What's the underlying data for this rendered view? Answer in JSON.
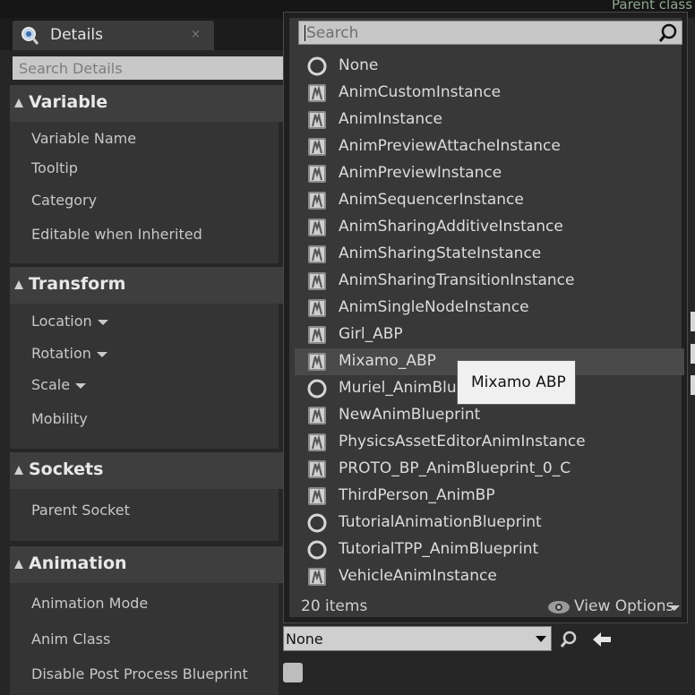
{
  "header": {
    "parent_class_label": "Parent class"
  },
  "details_tab": {
    "title": "Details",
    "close": "×"
  },
  "search_details": {
    "placeholder": "Search Details"
  },
  "categories": [
    {
      "name": "Variable",
      "props": [
        "Variable Name",
        "Tooltip",
        "Category",
        "Editable when Inherited"
      ]
    },
    {
      "name": "Transform",
      "props": [
        "Location",
        "Rotation",
        "Scale",
        "Mobility"
      ]
    },
    {
      "name": "Sockets",
      "props": [
        "Parent Socket"
      ]
    },
    {
      "name": "Animation",
      "props": [
        "Animation Mode",
        "Anim Class",
        "Disable Post Process Blueprint"
      ]
    }
  ],
  "class_picker": {
    "search_placeholder": "Search",
    "items": [
      {
        "label": "None",
        "icon": "circle-icon"
      },
      {
        "label": "AnimCustomInstance",
        "icon": "anim-blueprint-icon"
      },
      {
        "label": "AnimInstance",
        "icon": "anim-blueprint-icon"
      },
      {
        "label": "AnimPreviewAttacheInstance",
        "icon": "anim-blueprint-icon"
      },
      {
        "label": "AnimPreviewInstance",
        "icon": "anim-blueprint-icon"
      },
      {
        "label": "AnimSequencerInstance",
        "icon": "anim-blueprint-icon"
      },
      {
        "label": "AnimSharingAdditiveInstance",
        "icon": "anim-blueprint-icon"
      },
      {
        "label": "AnimSharingStateInstance",
        "icon": "anim-blueprint-icon"
      },
      {
        "label": "AnimSharingTransitionInstance",
        "icon": "anim-blueprint-icon"
      },
      {
        "label": "AnimSingleNodeInstance",
        "icon": "anim-blueprint-icon"
      },
      {
        "label": "Girl_ABP",
        "icon": "anim-blueprint-icon"
      },
      {
        "label": "Mixamo_ABP",
        "icon": "anim-blueprint-icon",
        "hovered": true
      },
      {
        "label": "Muriel_AnimBlueprint",
        "icon": "circle-icon"
      },
      {
        "label": "NewAnimBlueprint",
        "icon": "anim-blueprint-icon"
      },
      {
        "label": "PhysicsAssetEditorAnimInstance",
        "icon": "anim-blueprint-icon"
      },
      {
        "label": "PROTO_BP_AnimBlueprint_0_C",
        "icon": "anim-blueprint-icon"
      },
      {
        "label": "ThirdPerson_AnimBP",
        "icon": "anim-blueprint-icon"
      },
      {
        "label": "TutorialAnimationBlueprint",
        "icon": "circle-icon"
      },
      {
        "label": "TutorialTPP_AnimBlueprint",
        "icon": "circle-icon"
      },
      {
        "label": "VehicleAnimInstance",
        "icon": "anim-blueprint-icon"
      }
    ],
    "tooltip": "Mixamo ABP",
    "item_count": "20 items",
    "view_options": "View Options"
  },
  "anim_class_combo": {
    "value": "None"
  }
}
